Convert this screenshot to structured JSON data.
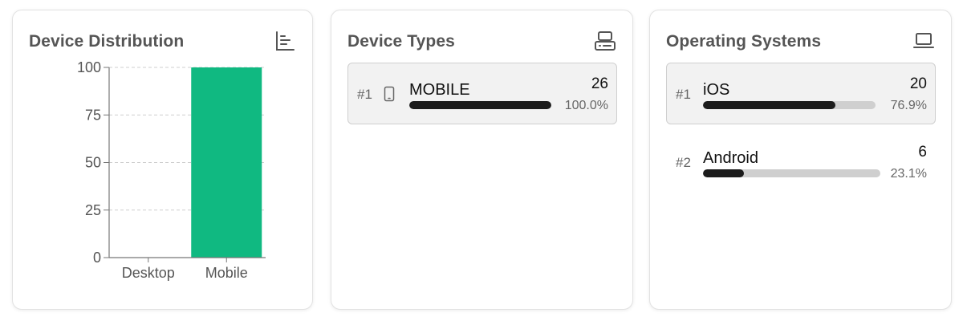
{
  "device_distribution": {
    "title": "Device Distribution",
    "icon": "bar-chart-icon"
  },
  "chart_data": {
    "type": "bar",
    "title": "Device Distribution",
    "categories": [
      "Desktop",
      "Mobile"
    ],
    "values": [
      0,
      100
    ],
    "ylim": [
      0,
      100
    ],
    "yticks": [
      0,
      25,
      50,
      75,
      100
    ],
    "ytick_labels": [
      "0",
      "25",
      "50",
      "75",
      "100"
    ],
    "grid": true,
    "bar_color": "#10b981"
  },
  "device_types": {
    "title": "Device Types",
    "icon": "server-icon",
    "items": [
      {
        "rank": "#1",
        "icon": "smartphone-icon",
        "label": "MOBILE",
        "count": "26",
        "percent": "100.0%",
        "fraction": 1.0
      }
    ]
  },
  "operating_systems": {
    "title": "Operating Systems",
    "icon": "laptop-icon",
    "items": [
      {
        "rank": "#1",
        "label": "iOS",
        "count": "20",
        "percent": "76.9%",
        "fraction": 0.769
      },
      {
        "rank": "#2",
        "label": "Android",
        "count": "6",
        "percent": "23.1%",
        "fraction": 0.231
      }
    ]
  },
  "colors": {
    "accent": "#10b981",
    "bar_dark": "#1c1c1c",
    "track": "#cfcfcf"
  }
}
